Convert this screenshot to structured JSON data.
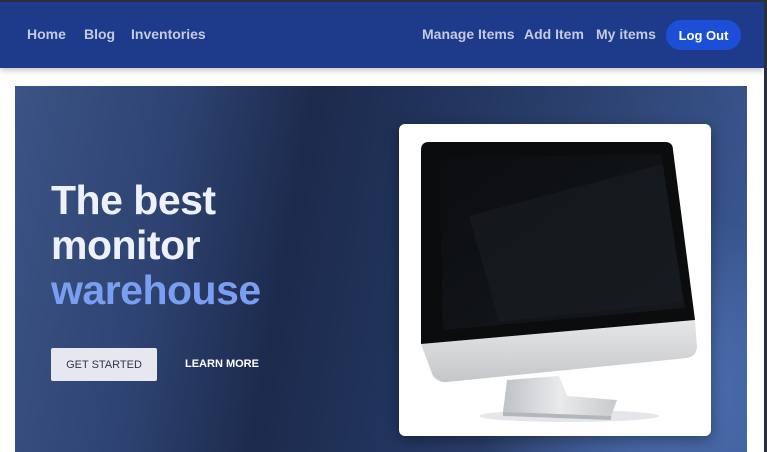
{
  "nav": {
    "left_links": [
      "Home",
      "Blog",
      "Inventories"
    ],
    "right_links": [
      "Manage Items",
      "Add Item",
      "My items"
    ],
    "logout_label": "Log Out"
  },
  "hero": {
    "title_line1": "The best",
    "title_line2": "monitor",
    "title_line3": "warehouse",
    "primary_button": "GET STARTED",
    "secondary_link": "LEARN MORE",
    "image_icon": "monitor-icon"
  },
  "colors": {
    "navbar": "#1e3a8a",
    "logout_button": "#1d4ed8",
    "accent_text": "#7a9ef2"
  }
}
